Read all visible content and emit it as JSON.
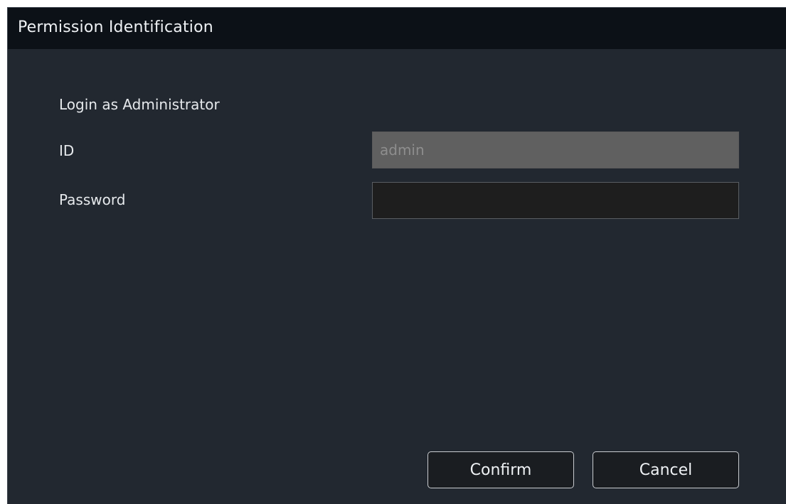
{
  "dialog": {
    "title": "Permission Identification",
    "section_label": "Login as Administrator",
    "id_label": "ID",
    "id_value": "admin",
    "password_label": "Password",
    "password_value": "",
    "confirm_label": "Confirm",
    "cancel_label": "Cancel"
  }
}
